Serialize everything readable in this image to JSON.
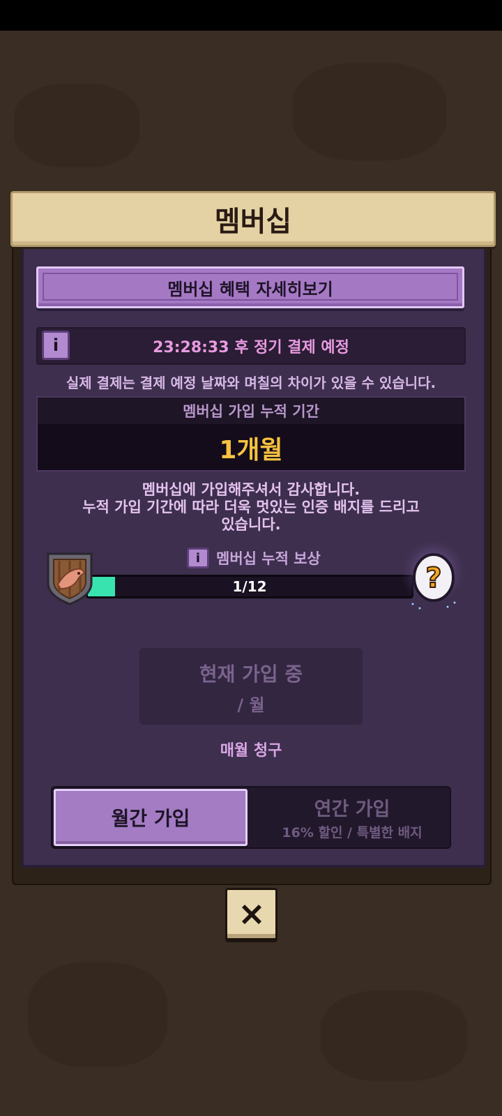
{
  "header": {
    "title": "멤버십"
  },
  "benefits_button": {
    "label": "멤버십 혜택 자세히보기"
  },
  "schedule": {
    "text": "23:28:33 후 정기 결제 예정"
  },
  "notice": "실제 결제는 결제 예정 날짜와 며칠의 차이가 있을 수 있습니다.",
  "period": {
    "label": "멤버십 가입 누적 기간",
    "value": "1개월"
  },
  "thanks": {
    "line1": "멤버십에 가입해주셔서 감사합니다.",
    "line2": "누적 가입 기간에 따라 더욱 멋있는 인증 배지를 드리고",
    "line3": "있습니다."
  },
  "reward": {
    "label": "멤버십 누적 보상",
    "progress_text": "1/12",
    "progress_fraction": 0.0833
  },
  "current": {
    "title": "현재 가입 중",
    "price": "/ 월"
  },
  "billing": "매월 청구",
  "plans": {
    "monthly_label": "월간 가입",
    "yearly_label": "연간 가입",
    "yearly_sub": "16% 할인 / 특별한 배지"
  },
  "icons": {
    "info": "info-icon",
    "shield": "shield-badge-icon",
    "egg": "mystery-egg-icon",
    "close": "close-icon"
  },
  "colors": {
    "accent": "#a578c4",
    "progress": "#38e3b0",
    "highlight": "#f6c23f"
  }
}
